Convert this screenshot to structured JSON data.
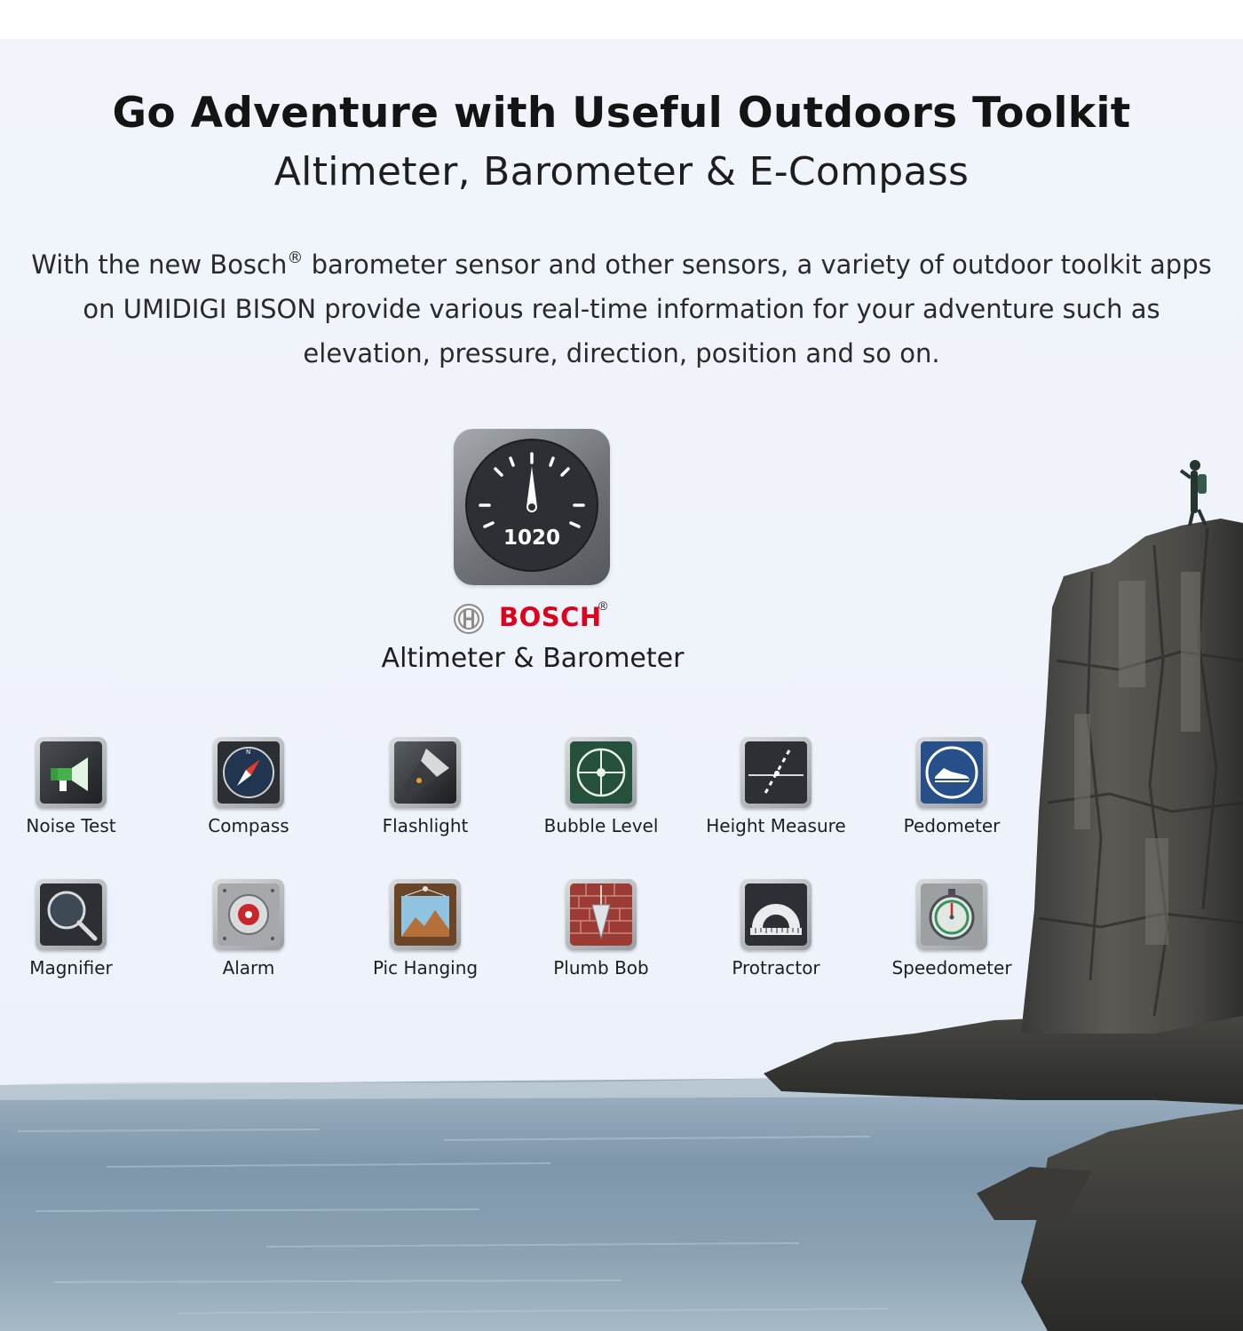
{
  "header": {
    "title": "Go Adventure with Useful Outdoors Toolkit",
    "subtitle": "Altimeter, Barometer & E-Compass"
  },
  "intro": {
    "part1": "With the new Bosch",
    "reg": "®",
    "part2": " barometer sensor and other sensors, a variety of outdoor toolkit apps on UMIDIGI BISON provide various real-time information for your adventure such as elevation, pressure, direction, position and so on."
  },
  "hero": {
    "gauge_value": "1020",
    "brand": "BOSCH",
    "brand_reg": "®",
    "label": "Altimeter & Barometer",
    "brand_color": "#e0001b"
  },
  "tools": [
    {
      "label": "Noise Test",
      "icon": "megaphone-icon"
    },
    {
      "label": "Compass",
      "icon": "compass-icon"
    },
    {
      "label": "Flashlight",
      "icon": "flashlight-icon"
    },
    {
      "label": "Bubble Level",
      "icon": "bubble-level-icon"
    },
    {
      "label": "Height Measure",
      "icon": "height-measure-icon"
    },
    {
      "label": "Pedometer",
      "icon": "shoe-icon"
    },
    {
      "label": "Magnifier",
      "icon": "magnifier-icon"
    },
    {
      "label": "Alarm",
      "icon": "alarm-icon"
    },
    {
      "label": "Pic Hanging",
      "icon": "picture-frame-icon"
    },
    {
      "label": "Plumb Bob",
      "icon": "plumb-bob-icon"
    },
    {
      "label": "Protractor",
      "icon": "protractor-icon"
    },
    {
      "label": "Speedometer",
      "icon": "stopwatch-icon"
    }
  ]
}
